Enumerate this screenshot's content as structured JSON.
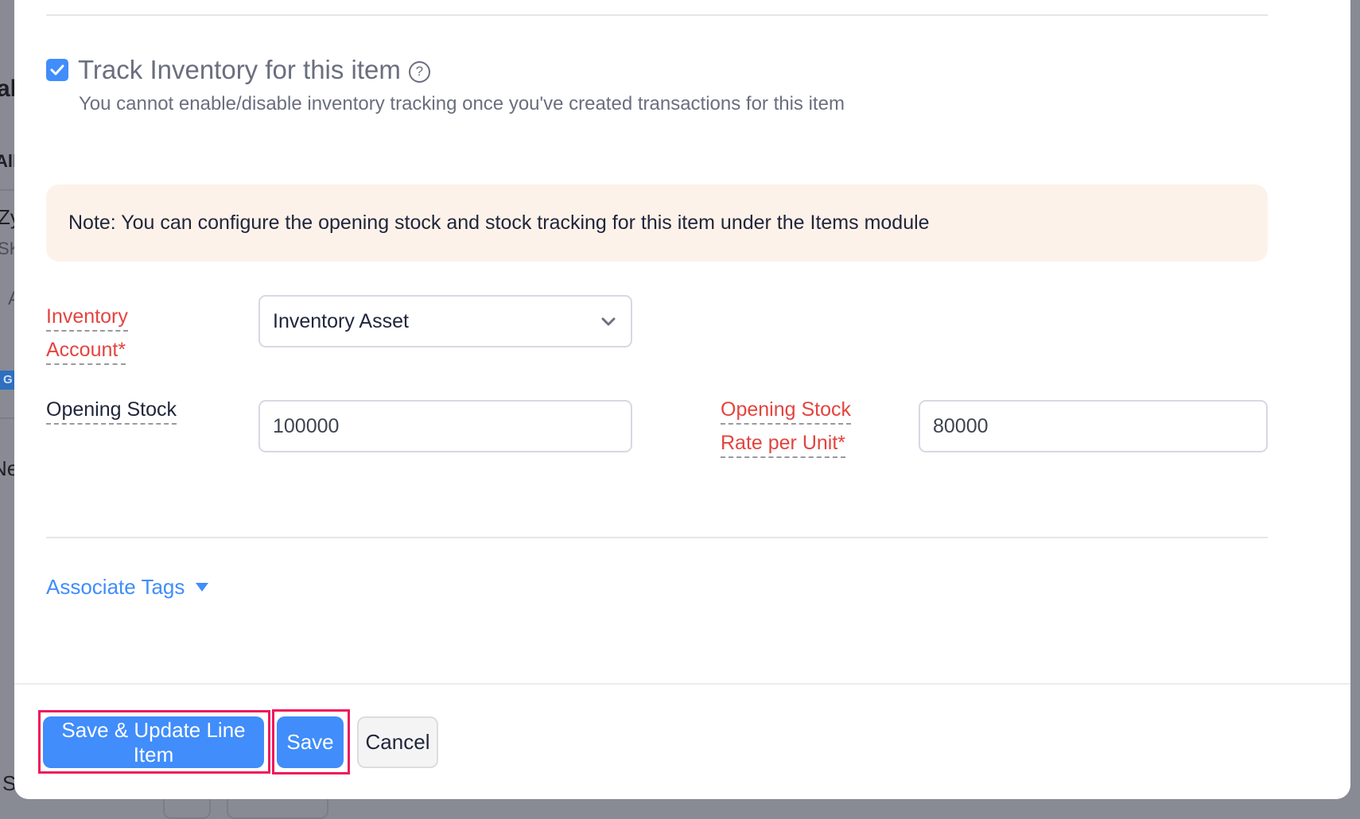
{
  "background": {
    "fragments": [
      "al",
      "All",
      "Zy",
      "SK",
      "A",
      "G",
      "Ne",
      "S"
    ]
  },
  "track_inventory": {
    "checked": true,
    "title": "Track Inventory for this item",
    "help_icon": "question-circle-icon",
    "help_glyph": "?",
    "subtitle": "You cannot enable/disable inventory tracking once you've created transactions for this item"
  },
  "note": {
    "text": "Note: You can configure the opening stock and stock tracking for this item under the Items module"
  },
  "form": {
    "inventory_account": {
      "label_line1": "Inventory",
      "label_line2": "Account*",
      "value": "Inventory Asset",
      "icon": "chevron-down-icon"
    },
    "opening_stock": {
      "label": "Opening Stock",
      "value": "100000"
    },
    "opening_stock_rate": {
      "label_line1": "Opening Stock",
      "label_line2": "Rate per Unit*",
      "value": "80000"
    }
  },
  "associate_tags": {
    "label": "Associate Tags",
    "icon": "caret-down-icon"
  },
  "footer": {
    "save_update_label": "Save & Update Line Item",
    "save_label": "Save",
    "cancel_label": "Cancel"
  },
  "colors": {
    "primary": "#408dfb",
    "required_label": "#e3443f",
    "note_bg": "#fdf2e9",
    "highlight": "#f0195a",
    "overlay": "#888b94"
  }
}
